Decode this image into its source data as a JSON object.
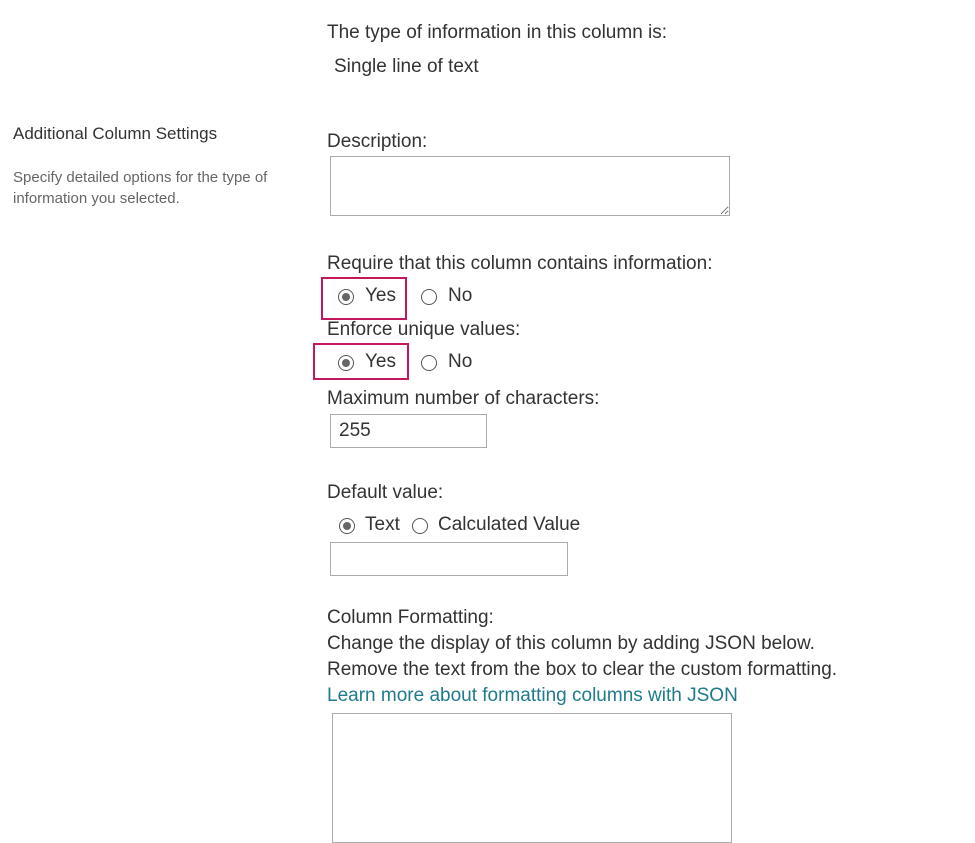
{
  "type_section": {
    "label": "The type of information in this column is:",
    "value": "Single line of text"
  },
  "sidebar": {
    "title": "Additional Column Settings",
    "description_line1": "Specify detailed options for the type of",
    "description_line2": "information you selected."
  },
  "description": {
    "label": "Description:",
    "value": ""
  },
  "require_info": {
    "label": "Require that this column contains information:",
    "yes_label": "Yes",
    "no_label": "No",
    "selected": "Yes"
  },
  "enforce_unique": {
    "label": "Enforce unique values:",
    "yes_label": "Yes",
    "no_label": "No",
    "selected": "Yes"
  },
  "max_chars": {
    "label": "Maximum number of characters:",
    "value": "255"
  },
  "default_value": {
    "label": "Default value:",
    "text_label": "Text",
    "calculated_label": "Calculated Value",
    "selected": "Text",
    "value": ""
  },
  "column_formatting": {
    "label": "Column Formatting:",
    "line1": "Change the display of this column by adding JSON below.",
    "line2": "Remove the text from the box to clear the custom formatting.",
    "link_text": "Learn more about formatting columns with JSON",
    "value": ""
  },
  "colors": {
    "highlight": "#c3185d",
    "link": "#1f7a8c"
  }
}
